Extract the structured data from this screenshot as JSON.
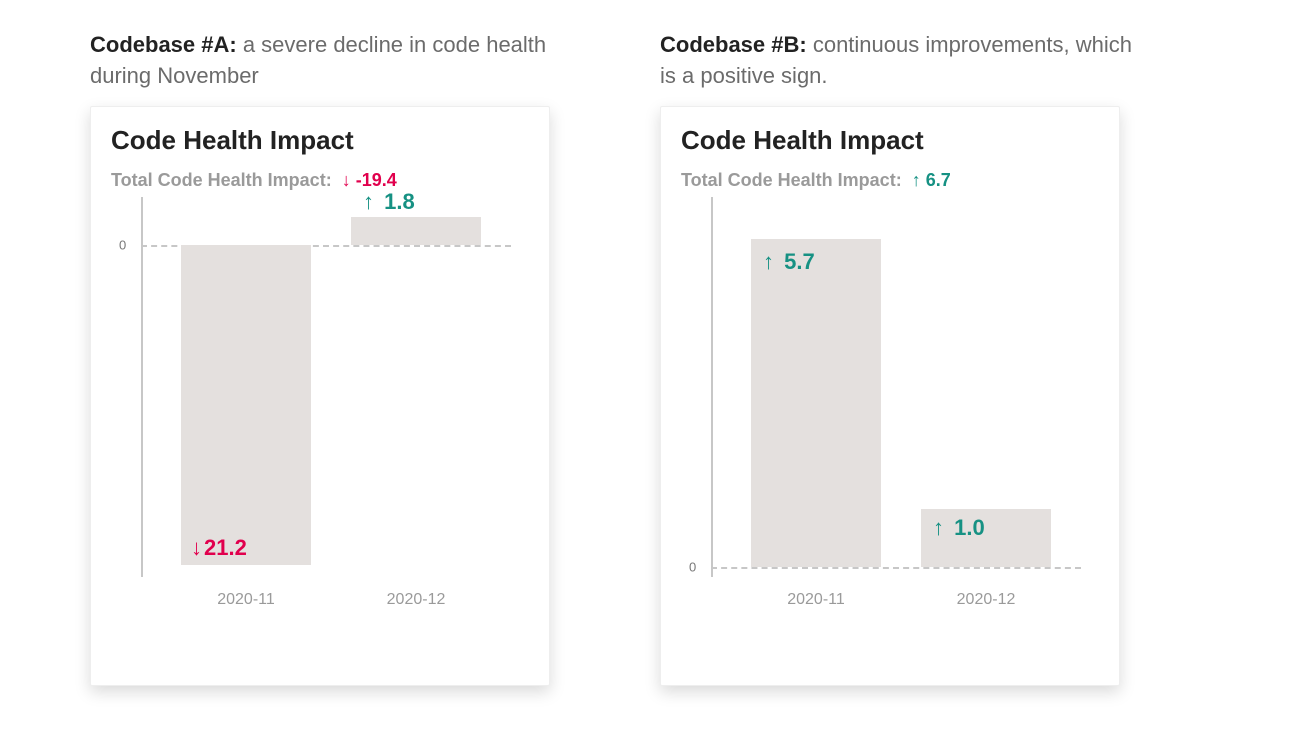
{
  "panels": {
    "a": {
      "caption_strong": "Codebase #A:",
      "caption_rest": " a severe decline in code health during November",
      "title": "Code Health Impact",
      "total_label": "Total Code Health Impact:",
      "total_arrow": "↓",
      "total_value": "-19.4",
      "total_class": "neg",
      "zero_label": "0",
      "bars": {
        "0": {
          "arrow": "↓",
          "value": "21.2",
          "class": "neg",
          "xtick": "2020-11"
        },
        "1": {
          "arrow": "↑",
          "value": "1.8",
          "class": "pos",
          "xtick": "2020-12"
        }
      }
    },
    "b": {
      "caption_strong": "Codebase #B:",
      "caption_rest": " continuous improvements, which is a positive sign.",
      "title": "Code Health Impact",
      "total_label": "Total Code Health Impact:",
      "total_arrow": "↑",
      "total_value": "6.7",
      "total_class": "pos",
      "zero_label": "0",
      "bars": {
        "0": {
          "arrow": "↑",
          "value": "5.7",
          "class": "pos",
          "xtick": "2020-11"
        },
        "1": {
          "arrow": "↑",
          "value": "1.0",
          "class": "pos",
          "xtick": "2020-12"
        }
      }
    }
  },
  "colors": {
    "positive": "#169183",
    "negative": "#e1004d",
    "bar_fill": "#e4e0de"
  },
  "chart_data": [
    {
      "type": "bar",
      "title": "Code Health Impact",
      "subtitle": "Codebase #A",
      "total_label": "Total Code Health Impact",
      "total_value": -19.4,
      "categories": [
        "2020-11",
        "2020-12"
      ],
      "values": [
        -21.2,
        1.8
      ],
      "xlabel": "",
      "ylabel": "",
      "ylim": [
        -22,
        2
      ]
    },
    {
      "type": "bar",
      "title": "Code Health Impact",
      "subtitle": "Codebase #B",
      "total_label": "Total Code Health Impact",
      "total_value": 6.7,
      "categories": [
        "2020-11",
        "2020-12"
      ],
      "values": [
        5.7,
        1.0
      ],
      "xlabel": "",
      "ylabel": "",
      "ylim": [
        0,
        6
      ]
    }
  ]
}
